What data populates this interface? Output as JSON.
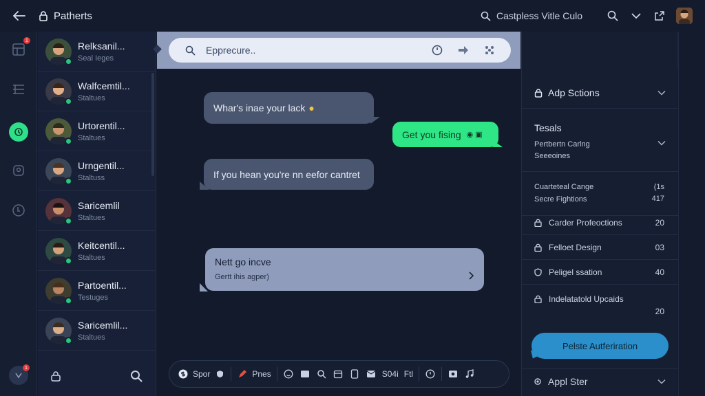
{
  "app": {
    "title": "Patherts",
    "back_icon": "arrow-left-icon",
    "title_icon": "lock-icon"
  },
  "top": {
    "search_label": "Castpless Vitle Culo",
    "actions": [
      "search-icon",
      "chevron-down-icon",
      "external-link-icon",
      "user-avatar"
    ]
  },
  "rail": {
    "badge_count": "1",
    "bottom_badge": "1"
  },
  "contacts": {
    "items": [
      {
        "name": "Relksanil...",
        "status": "Seal Ieges"
      },
      {
        "name": "Walfcemtil...",
        "status": "Staltues"
      },
      {
        "name": "Urtorentil...",
        "status": "Staltues"
      },
      {
        "name": "Urngentil...",
        "status": "Staltuss"
      },
      {
        "name": "Saricemlil",
        "status": "Staltues"
      },
      {
        "name": "Keitcentil...",
        "status": "Staltues"
      },
      {
        "name": "Partoentil...",
        "status": "Testuges"
      },
      {
        "name": "Saricemlil...",
        "status": "Staltues"
      }
    ]
  },
  "chat": {
    "search_placeholder": "Epprecure..",
    "messages": [
      {
        "direction": "in",
        "text": "Whar's inae your lack"
      },
      {
        "direction": "out",
        "text": "Get you fising"
      },
      {
        "direction": "in",
        "text": "If you hean you're nn eefor cantret"
      }
    ],
    "card": {
      "title": "Nett go incve",
      "subtitle": "Gertt ihis agper)"
    },
    "composer": {
      "chip1": "Spor",
      "chip2": "Pnes",
      "chip3": "S04i",
      "chip4": "Ftl"
    }
  },
  "right": {
    "header": "Adp Sctions",
    "section_title": "Tesals",
    "section_sub1": "Pertbertn Carlng",
    "section_sub2": "Seeeoines",
    "item2": {
      "line1": "Cuarteteal Cange",
      "line2": "Secre Fightions",
      "value1": "(1s",
      "value2": "417"
    },
    "lines": [
      {
        "label": "Carder Profeoctions",
        "value": "20"
      },
      {
        "label": "Felloet Design",
        "value": "03"
      },
      {
        "label": "Peligel ssation",
        "value": "40"
      }
    ],
    "tall": {
      "label": "Indelatatold Upcaids",
      "value": "20"
    },
    "button": "Pelste Autferiration",
    "footer": "Appl Ster"
  },
  "colors": {
    "accent_green": "#2ee686",
    "accent_blue": "#2a8fcb",
    "badge_red": "#e23a3a"
  }
}
